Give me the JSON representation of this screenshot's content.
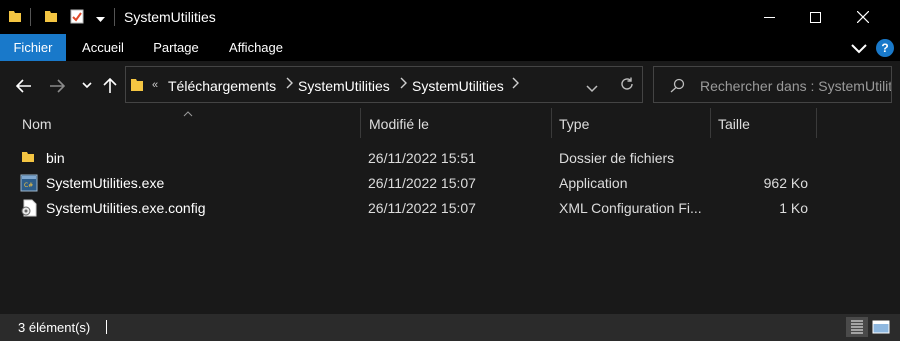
{
  "window": {
    "title": "SystemUtilities"
  },
  "ribbon": {
    "tabs": [
      {
        "label": "Fichier"
      },
      {
        "label": "Accueil"
      },
      {
        "label": "Partage"
      },
      {
        "label": "Affichage"
      }
    ],
    "help_label": "?"
  },
  "address": {
    "overflow": "«",
    "breadcrumbs": [
      "Téléchargements",
      "SystemUtilities",
      "SystemUtilities"
    ]
  },
  "search": {
    "placeholder": "Rechercher dans : SystemUtilities"
  },
  "columns": {
    "name": "Nom",
    "modified": "Modifié le",
    "type": "Type",
    "size": "Taille"
  },
  "files": [
    {
      "name": "bin",
      "modified": "26/11/2022 15:51",
      "type": "Dossier de fichiers",
      "size": "",
      "icon": "folder-icon"
    },
    {
      "name": "SystemUtilities.exe",
      "modified": "26/11/2022 15:07",
      "type": "Application",
      "size": "962 Ko",
      "icon": "exe-icon"
    },
    {
      "name": "SystemUtilities.exe.config",
      "modified": "26/11/2022 15:07",
      "type": "XML Configuration Fi...",
      "size": "1 Ko",
      "icon": "config-file-icon"
    }
  ],
  "status": {
    "count": "3 élément(s)"
  },
  "colors": {
    "accent": "#1979ca",
    "background": "#191919",
    "titlebar": "#000000",
    "folder": "#f4c542"
  }
}
